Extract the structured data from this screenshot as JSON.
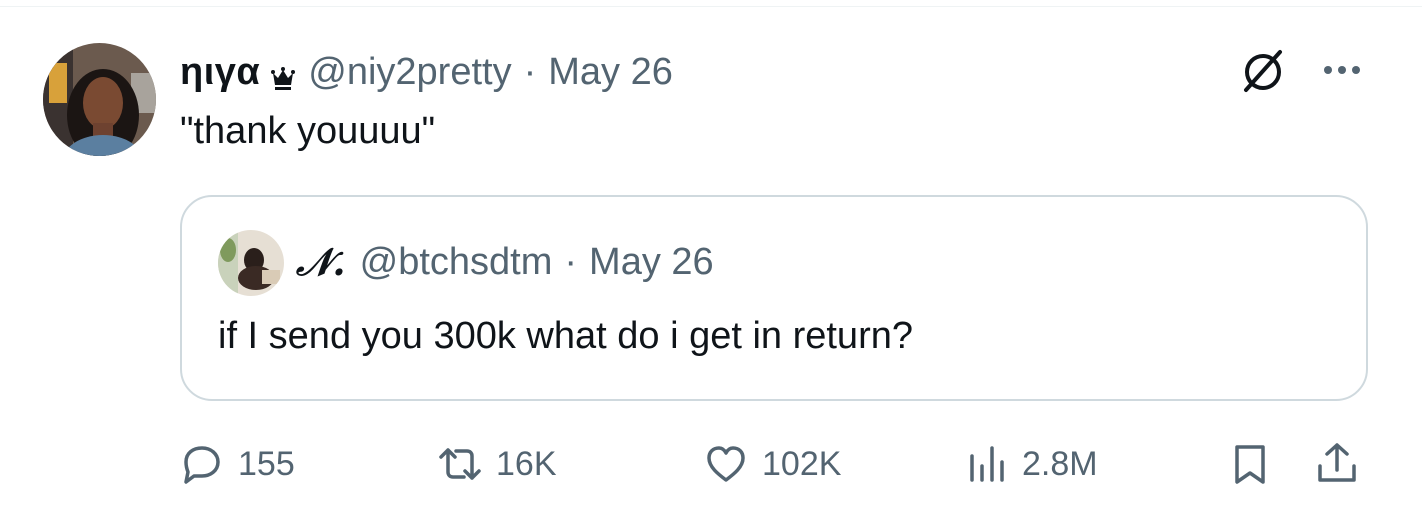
{
  "tweet": {
    "author": {
      "display_name": "ηιγα",
      "badge_icon": "crown-icon",
      "handle": "@niy2pretty",
      "separator": "·",
      "date": "May 26"
    },
    "text": "\"thank youuuu\"",
    "header_icons": [
      "grok-icon",
      "more-icon"
    ],
    "quote": {
      "author": {
        "display_name": "𝒩.",
        "handle": "@btchsdtm",
        "separator": "·",
        "date": "May 26"
      },
      "text": "if I send you 300k what do i get in return?"
    },
    "actions": {
      "replies": "155",
      "retweets": "16K",
      "likes": "102K",
      "views": "2.8M"
    },
    "colors": {
      "text_primary": "#0f1419",
      "text_secondary": "#536471",
      "border": "#cfd9de"
    }
  }
}
